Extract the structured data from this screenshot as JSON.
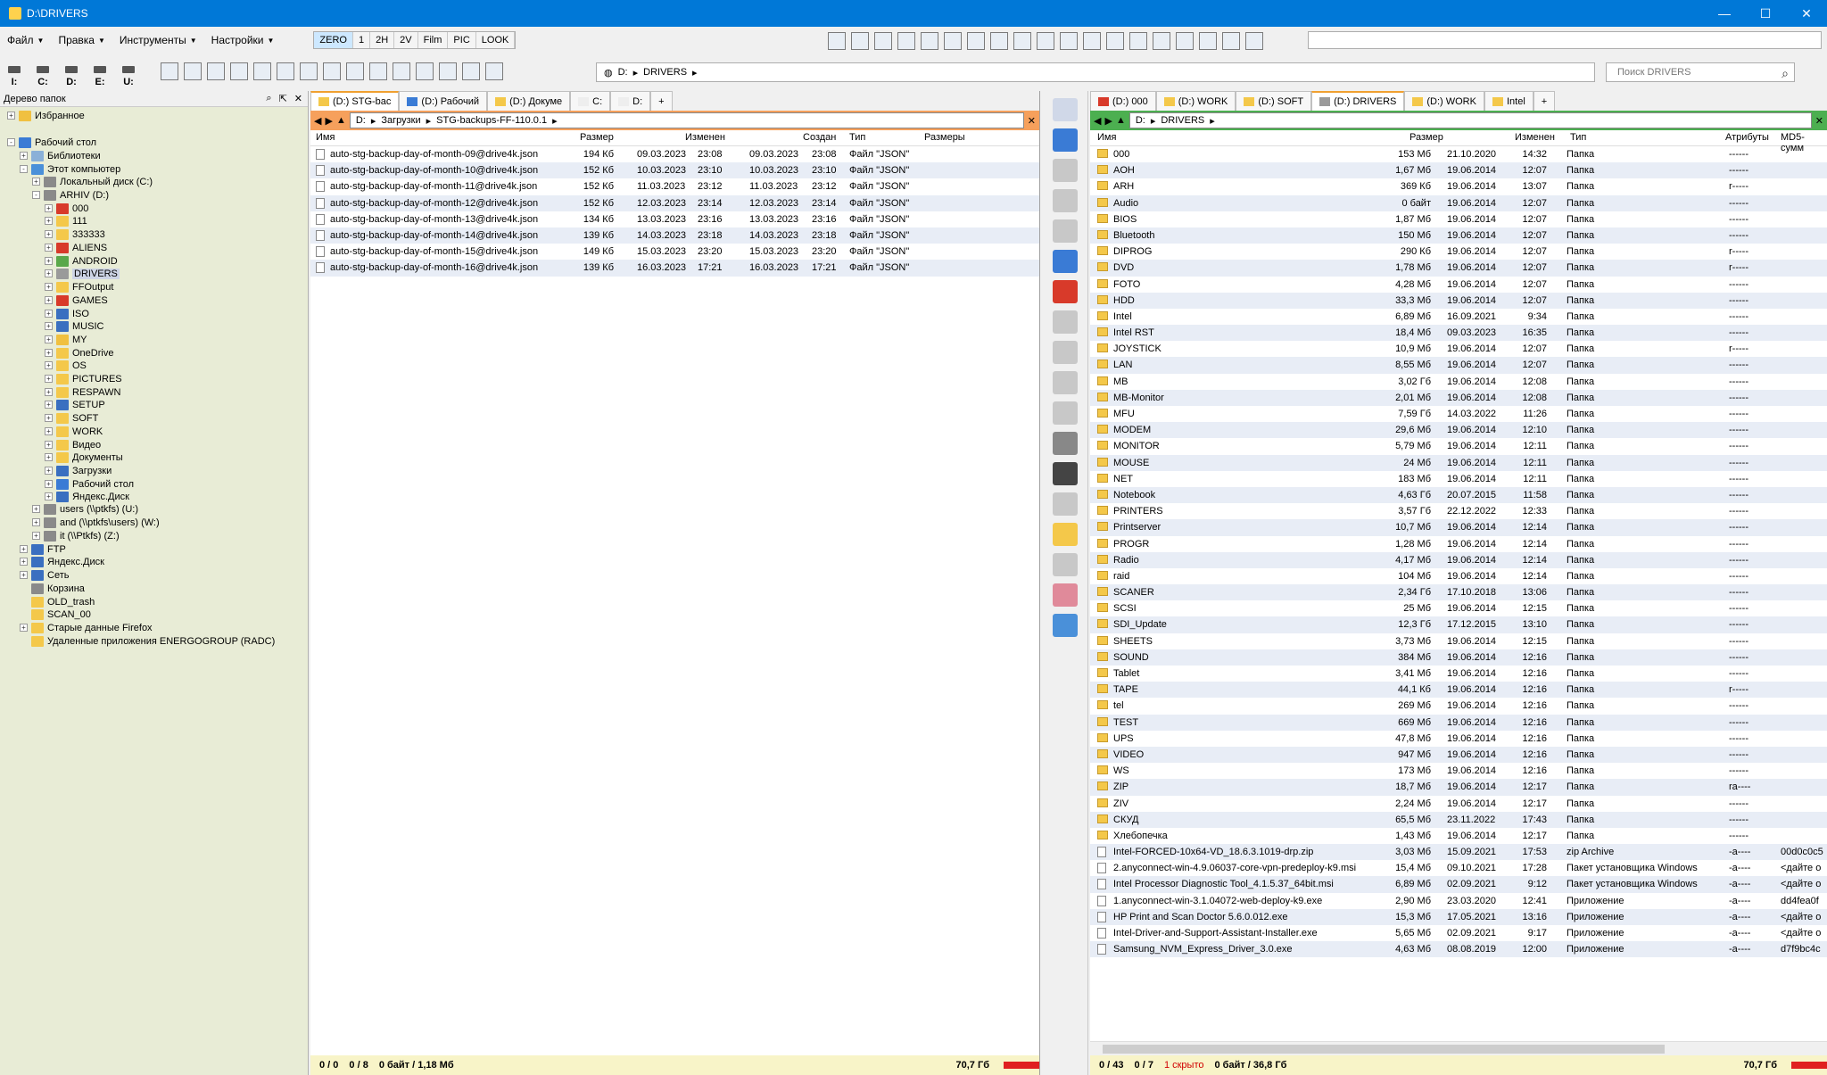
{
  "window": {
    "title": "D:\\DRIVERS"
  },
  "menu": [
    {
      "label": "Файл"
    },
    {
      "label": "Правка"
    },
    {
      "label": "Инструменты"
    },
    {
      "label": "Настройки"
    }
  ],
  "modes": [
    "ZERO",
    "1",
    "2H",
    "2V",
    "Film",
    "PIC",
    "LOOK"
  ],
  "drives": [
    "I:",
    "C:",
    "D:",
    "E:",
    "U:"
  ],
  "path_top": {
    "crumbs": [
      "D:",
      "DRIVERS"
    ]
  },
  "search": {
    "placeholder": "Поиск DRIVERS"
  },
  "tree": {
    "header": "Дерево папок",
    "nodes": [
      {
        "label": "Избранное",
        "level": 0,
        "icon": "star",
        "exp": "+"
      },
      {
        "label": "Рабочий стол",
        "level": 0,
        "icon": "desktop",
        "exp": "-"
      },
      {
        "label": "Библиотеки",
        "level": 1,
        "icon": "library",
        "exp": "+"
      },
      {
        "label": "Этот компьютер",
        "level": 1,
        "icon": "computer",
        "exp": "-"
      },
      {
        "label": "Локальный диск (C:)",
        "level": 2,
        "icon": "drive",
        "exp": "+"
      },
      {
        "label": "ARHIV (D:)",
        "level": 2,
        "icon": "drive",
        "exp": "-"
      },
      {
        "label": "000",
        "level": 3,
        "icon": "red",
        "exp": "+"
      },
      {
        "label": "111",
        "level": 3,
        "icon": "folder",
        "exp": "+"
      },
      {
        "label": "333333",
        "level": 3,
        "icon": "folder",
        "exp": "+"
      },
      {
        "label": "ALIENS",
        "level": 3,
        "icon": "red",
        "exp": "+"
      },
      {
        "label": "ANDROID",
        "level": 3,
        "icon": "green",
        "exp": "+"
      },
      {
        "label": "DRIVERS",
        "level": 3,
        "icon": "gear",
        "exp": "+",
        "selected": true
      },
      {
        "label": "FFOutput",
        "level": 3,
        "icon": "folder",
        "exp": "+"
      },
      {
        "label": "GAMES",
        "level": 3,
        "icon": "red",
        "exp": "+"
      },
      {
        "label": "ISO",
        "level": 3,
        "icon": "blue",
        "exp": "+"
      },
      {
        "label": "MUSIC",
        "level": 3,
        "icon": "blue",
        "exp": "+"
      },
      {
        "label": "MY",
        "level": 3,
        "icon": "star",
        "exp": "+"
      },
      {
        "label": "OneDrive",
        "level": 3,
        "icon": "folder",
        "exp": "+"
      },
      {
        "label": "OS",
        "level": 3,
        "icon": "folder",
        "exp": "+"
      },
      {
        "label": "PICTURES",
        "level": 3,
        "icon": "folder",
        "exp": "+"
      },
      {
        "label": "RESPAWN",
        "level": 3,
        "icon": "folder",
        "exp": "+"
      },
      {
        "label": "SETUP",
        "level": 3,
        "icon": "blue",
        "exp": "+"
      },
      {
        "label": "SOFT",
        "level": 3,
        "icon": "folder",
        "exp": "+"
      },
      {
        "label": "WORK",
        "level": 3,
        "icon": "folder",
        "exp": "+"
      },
      {
        "label": "Видео",
        "level": 3,
        "icon": "folder",
        "exp": "+"
      },
      {
        "label": "Документы",
        "level": 3,
        "icon": "folder",
        "exp": "+"
      },
      {
        "label": "Загрузки",
        "level": 3,
        "icon": "blue",
        "exp": "+"
      },
      {
        "label": "Рабочий стол",
        "level": 3,
        "icon": "desktop",
        "exp": "+"
      },
      {
        "label": "Яндекс.Диск",
        "level": 3,
        "icon": "blue",
        "exp": "+"
      },
      {
        "label": "users (\\\\ptkfs) (U:)",
        "level": 2,
        "icon": "drive",
        "exp": "+"
      },
      {
        "label": "and (\\\\ptkfs\\users) (W:)",
        "level": 2,
        "icon": "drive",
        "exp": "+"
      },
      {
        "label": "it (\\\\Ptkfs) (Z:)",
        "level": 2,
        "icon": "drive",
        "exp": "+"
      },
      {
        "label": "FTP",
        "level": 1,
        "icon": "blue",
        "exp": "+"
      },
      {
        "label": "Яндекс.Диск",
        "level": 1,
        "icon": "blue",
        "exp": "+"
      },
      {
        "label": "Сеть",
        "level": 1,
        "icon": "blue",
        "exp": "+"
      },
      {
        "label": "Корзина",
        "level": 1,
        "icon": "drive",
        "exp": ""
      },
      {
        "label": "OLD_trash",
        "level": 1,
        "icon": "folder",
        "exp": ""
      },
      {
        "label": "SCAN_00",
        "level": 1,
        "icon": "folder",
        "exp": ""
      },
      {
        "label": "Старые данные Firefox",
        "level": 1,
        "icon": "folder",
        "exp": "+"
      },
      {
        "label": "Удаленные приложения ENERGOGROUP (RADC)",
        "level": 1,
        "icon": "folder",
        "exp": ""
      }
    ]
  },
  "left": {
    "tabs": [
      "(D:) STG-bac",
      "(D:) Рабочий",
      "(D:) Докуме",
      "C:",
      "D:"
    ],
    "crumbs": [
      "D:",
      "Загрузки",
      "STG-backups-FF-110.0.1"
    ],
    "columns": [
      "Имя",
      "Размер",
      "Изменен",
      "Создан",
      "Тип",
      "Размеры"
    ],
    "rows": [
      [
        "auto-stg-backup-day-of-month-09@drive4k.json",
        "194 Кб",
        "09.03.2023",
        "23:08",
        "09.03.2023",
        "23:08",
        "Файл \"JSON\""
      ],
      [
        "auto-stg-backup-day-of-month-10@drive4k.json",
        "152 Кб",
        "10.03.2023",
        "23:10",
        "10.03.2023",
        "23:10",
        "Файл \"JSON\""
      ],
      [
        "auto-stg-backup-day-of-month-11@drive4k.json",
        "152 Кб",
        "11.03.2023",
        "23:12",
        "11.03.2023",
        "23:12",
        "Файл \"JSON\""
      ],
      [
        "auto-stg-backup-day-of-month-12@drive4k.json",
        "152 Кб",
        "12.03.2023",
        "23:14",
        "12.03.2023",
        "23:14",
        "Файл \"JSON\""
      ],
      [
        "auto-stg-backup-day-of-month-13@drive4k.json",
        "134 Кб",
        "13.03.2023",
        "23:16",
        "13.03.2023",
        "23:16",
        "Файл \"JSON\""
      ],
      [
        "auto-stg-backup-day-of-month-14@drive4k.json",
        "139 Кб",
        "14.03.2023",
        "23:18",
        "14.03.2023",
        "23:18",
        "Файл \"JSON\""
      ],
      [
        "auto-stg-backup-day-of-month-15@drive4k.json",
        "149 Кб",
        "15.03.2023",
        "23:20",
        "15.03.2023",
        "23:20",
        "Файл \"JSON\""
      ],
      [
        "auto-stg-backup-day-of-month-16@drive4k.json",
        "139 Кб",
        "16.03.2023",
        "17:21",
        "16.03.2023",
        "17:21",
        "Файл \"JSON\""
      ]
    ],
    "status": {
      "sel1": "0 / 0",
      "sel2": "0 / 8",
      "size": "0 байт / 1,18 Мб",
      "free": "70,7 Гб"
    }
  },
  "right": {
    "tabs": [
      "(D:) 000",
      "(D:) WORK",
      "(D:) SOFT",
      "(D:) DRIVERS",
      "(D:) WORK",
      "Intel"
    ],
    "crumbs": [
      "D:",
      "DRIVERS"
    ],
    "columns": [
      "Имя",
      "Размер",
      "Изменен",
      "Тип",
      "Атрибуты",
      "MD5-сумм"
    ],
    "rows": [
      [
        "000",
        "153 Мб",
        "21.10.2020",
        "14:32",
        "Папка",
        "------",
        ""
      ],
      [
        "AOH",
        "1,67 Мб",
        "19.06.2014",
        "12:07",
        "Папка",
        "------",
        ""
      ],
      [
        "ARH",
        "369 Кб",
        "19.06.2014",
        "13:07",
        "Папка",
        "r-----",
        ""
      ],
      [
        "Audio",
        "0 байт",
        "19.06.2014",
        "12:07",
        "Папка",
        "------",
        ""
      ],
      [
        "BIOS",
        "1,87 Мб",
        "19.06.2014",
        "12:07",
        "Папка",
        "------",
        ""
      ],
      [
        "Bluetooth",
        "150 Мб",
        "19.06.2014",
        "12:07",
        "Папка",
        "------",
        ""
      ],
      [
        "DIPROG",
        "290 Кб",
        "19.06.2014",
        "12:07",
        "Папка",
        "r-----",
        ""
      ],
      [
        "DVD",
        "1,78 Мб",
        "19.06.2014",
        "12:07",
        "Папка",
        "r-----",
        ""
      ],
      [
        "FOTO",
        "4,28 Мб",
        "19.06.2014",
        "12:07",
        "Папка",
        "------",
        ""
      ],
      [
        "HDD",
        "33,3 Мб",
        "19.06.2014",
        "12:07",
        "Папка",
        "------",
        ""
      ],
      [
        "Intel",
        "6,89 Мб",
        "16.09.2021",
        "9:34",
        "Папка",
        "------",
        ""
      ],
      [
        "Intel RST",
        "18,4 Мб",
        "09.03.2023",
        "16:35",
        "Папка",
        "------",
        ""
      ],
      [
        "JOYSTICK",
        "10,9 Мб",
        "19.06.2014",
        "12:07",
        "Папка",
        "r-----",
        ""
      ],
      [
        "LAN",
        "8,55 Мб",
        "19.06.2014",
        "12:07",
        "Папка",
        "------",
        ""
      ],
      [
        "MB",
        "3,02 Гб",
        "19.06.2014",
        "12:08",
        "Папка",
        "------",
        ""
      ],
      [
        "MB-Monitor",
        "2,01 Мб",
        "19.06.2014",
        "12:08",
        "Папка",
        "------",
        ""
      ],
      [
        "MFU",
        "7,59 Гб",
        "14.03.2022",
        "11:26",
        "Папка",
        "------",
        ""
      ],
      [
        "MODEM",
        "29,6 Мб",
        "19.06.2014",
        "12:10",
        "Папка",
        "------",
        ""
      ],
      [
        "MONITOR",
        "5,79 Мб",
        "19.06.2014",
        "12:11",
        "Папка",
        "------",
        ""
      ],
      [
        "MOUSE",
        "24 Мб",
        "19.06.2014",
        "12:11",
        "Папка",
        "------",
        ""
      ],
      [
        "NET",
        "183 Мб",
        "19.06.2014",
        "12:11",
        "Папка",
        "------",
        ""
      ],
      [
        "Notebook",
        "4,63 Гб",
        "20.07.2015",
        "11:58",
        "Папка",
        "------",
        ""
      ],
      [
        "PRINTERS",
        "3,57 Гб",
        "22.12.2022",
        "12:33",
        "Папка",
        "------",
        ""
      ],
      [
        "Printserver",
        "10,7 Мб",
        "19.06.2014",
        "12:14",
        "Папка",
        "------",
        ""
      ],
      [
        "PROGR",
        "1,28 Мб",
        "19.06.2014",
        "12:14",
        "Папка",
        "------",
        ""
      ],
      [
        "Radio",
        "4,17 Мб",
        "19.06.2014",
        "12:14",
        "Папка",
        "------",
        ""
      ],
      [
        "raid",
        "104 Мб",
        "19.06.2014",
        "12:14",
        "Папка",
        "------",
        ""
      ],
      [
        "SCANER",
        "2,34 Гб",
        "17.10.2018",
        "13:06",
        "Папка",
        "------",
        ""
      ],
      [
        "SCSI",
        "25 Мб",
        "19.06.2014",
        "12:15",
        "Папка",
        "------",
        ""
      ],
      [
        "SDI_Update",
        "12,3 Гб",
        "17.12.2015",
        "13:10",
        "Папка",
        "------",
        ""
      ],
      [
        "SHEETS",
        "3,73 Мб",
        "19.06.2014",
        "12:15",
        "Папка",
        "------",
        ""
      ],
      [
        "SOUND",
        "384 Мб",
        "19.06.2014",
        "12:16",
        "Папка",
        "------",
        ""
      ],
      [
        "Tablet",
        "3,41 Мб",
        "19.06.2014",
        "12:16",
        "Папка",
        "------",
        ""
      ],
      [
        "TAPE",
        "44,1 Кб",
        "19.06.2014",
        "12:16",
        "Папка",
        "r-----",
        ""
      ],
      [
        "tel",
        "269 Мб",
        "19.06.2014",
        "12:16",
        "Папка",
        "------",
        ""
      ],
      [
        "TEST",
        "669 Мб",
        "19.06.2014",
        "12:16",
        "Папка",
        "------",
        ""
      ],
      [
        "UPS",
        "47,8 Мб",
        "19.06.2014",
        "12:16",
        "Папка",
        "------",
        ""
      ],
      [
        "VIDEO",
        "947 Мб",
        "19.06.2014",
        "12:16",
        "Папка",
        "------",
        ""
      ],
      [
        "WS",
        "173 Мб",
        "19.06.2014",
        "12:16",
        "Папка",
        "------",
        ""
      ],
      [
        "ZIP",
        "18,7 Мб",
        "19.06.2014",
        "12:17",
        "Папка",
        "ra----",
        ""
      ],
      [
        "ZIV",
        "2,24 Мб",
        "19.06.2014",
        "12:17",
        "Папка",
        "------",
        ""
      ],
      [
        "СКУД",
        "65,5 Мб",
        "23.11.2022",
        "17:43",
        "Папка",
        "------",
        ""
      ],
      [
        "Хлебопечка",
        "1,43 Мб",
        "19.06.2014",
        "12:17",
        "Папка",
        "------",
        ""
      ],
      [
        "Intel-FORCED-10x64-VD_18.6.3.1019-drp.zip",
        "3,03 Мб",
        "15.09.2021",
        "17:53",
        "zip Archive",
        "-a----",
        "00d0c0c5"
      ],
      [
        "2.anyconnect-win-4.9.06037-core-vpn-predeploy-k9.msi",
        "15,4 Мб",
        "09.10.2021",
        "17:28",
        "Пакет установщика Windows",
        "-a----",
        "<дайте о"
      ],
      [
        "Intel Processor Diagnostic Tool_4.1.5.37_64bit.msi",
        "6,89 Мб",
        "02.09.2021",
        "9:12",
        "Пакет установщика Windows",
        "-a----",
        "<дайте о"
      ],
      [
        "1.anyconnect-win-3.1.04072-web-deploy-k9.exe",
        "2,90 Мб",
        "23.03.2020",
        "12:41",
        "Приложение",
        "-a----",
        "dd4fea0f"
      ],
      [
        "HP Print and Scan Doctor 5.6.0.012.exe",
        "15,3 Мб",
        "17.05.2021",
        "13:16",
        "Приложение",
        "-a----",
        "<дайте о"
      ],
      [
        "Intel-Driver-and-Support-Assistant-Installer.exe",
        "5,65 Мб",
        "02.09.2021",
        "9:17",
        "Приложение",
        "-a----",
        "<дайте о"
      ],
      [
        "Samsung_NVM_Express_Driver_3.0.exe",
        "4,63 Мб",
        "08.08.2019",
        "12:00",
        "Приложение",
        "-a----",
        "d7f9bc4c"
      ]
    ],
    "status": {
      "sel1": "0 / 43",
      "sel2": "0 / 7",
      "hidden": "1 скрыто",
      "size": "0 байт / 36,8 Гб",
      "free": "70,7 Гб"
    }
  }
}
